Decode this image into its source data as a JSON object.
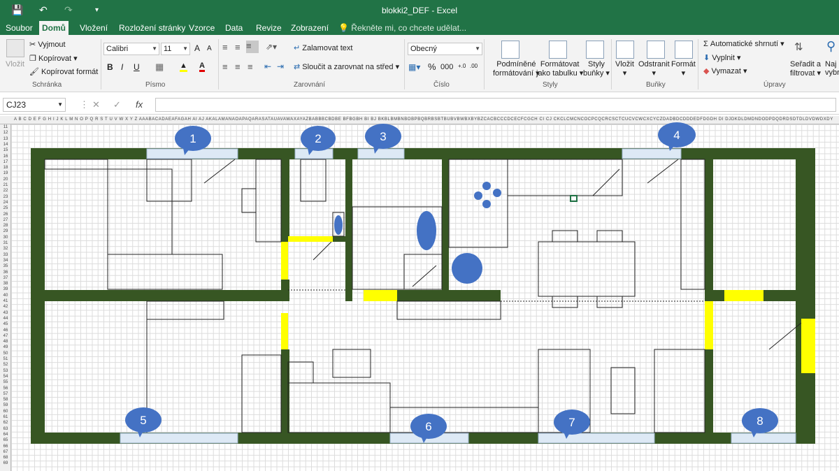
{
  "app": {
    "title": "blokki2_DEF - Excel"
  },
  "menu": {
    "tabs": [
      "Soubor",
      "Domů",
      "Vložení",
      "Rozložení stránky",
      "Vzorce",
      "Data",
      "Revize",
      "Zobrazení"
    ],
    "active_tab": "Domů",
    "tell_me": "Řekněte mi, co chcete udělat..."
  },
  "ribbon": {
    "clipboard": {
      "paste": "Vložit",
      "cut": "Vyjmout",
      "copy": "Kopírovat",
      "format_painter": "Kopírovat formát",
      "group": "Schránka"
    },
    "font": {
      "name": "Calibri",
      "size": "11",
      "bold": "B",
      "italic": "I",
      "underline": "U",
      "grow": "A",
      "shrink": "A",
      "group": "Písmo"
    },
    "alignment": {
      "wrap": "Zalamovat text",
      "merge": "Sloučit a zarovnat na střed",
      "group": "Zarovnání"
    },
    "number": {
      "format": "Obecný",
      "group": "Číslo"
    },
    "styles": {
      "conditional": [
        "Podmíněné",
        "formátování"
      ],
      "as_table": [
        "Formátovat",
        "jako tabulku"
      ],
      "cell_styles": [
        "Styly",
        "buňky"
      ],
      "group": "Styly"
    },
    "cells": {
      "insert": "Vložit",
      "delete": "Odstranit",
      "format": "Formát",
      "group": "Buňky"
    },
    "editing": {
      "autosum": "Automatické shrnutí",
      "fill": "Vyplnit",
      "clear": "Vymazat",
      "sort": [
        "Seřadit a",
        "filtrovat"
      ],
      "find": [
        "Naj",
        "vybra"
      ],
      "group": "Úpravy"
    }
  },
  "formula_bar": {
    "name_box": "CJ23",
    "fx": "fx",
    "value": ""
  },
  "column_headers": "A B C D E F G H I J K L M N O P Q R S T U V W X Y Z AAABACADAEAFAGAH AI AJ AKALAMANAOAPAQARASATAUAVAWAXAYAZBABBBCBDBE BFBGBH BI BJ BKBLBMBNBOBPBQBRBSBTBUBVBWBXBYBZCACBCCCDCECFCGCH CI CJ CKCLCMCNCOCPCQCRCSCTCUCVCWCXCYCZDADBDCDDDEDFDGDH DI DJDKDLDMDNDODPDQDRDSDTDLDVDWDXDY",
  "row_headers": [
    "11",
    "12",
    "13",
    "14",
    "15",
    "16",
    "17",
    "18",
    "19",
    "20",
    "21",
    "22",
    "23",
    "24",
    "25",
    "26",
    "27",
    "28",
    "29",
    "30",
    "31",
    "32",
    "33",
    "34",
    "35",
    "36",
    "37",
    "38",
    "39",
    "40",
    "41",
    "42",
    "43",
    "44",
    "45",
    "46",
    "47",
    "48",
    "49",
    "50",
    "51",
    "52",
    "53",
    "54",
    "55",
    "56",
    "57",
    "58",
    "59",
    "60",
    "61",
    "62",
    "63",
    "64",
    "65",
    "66",
    "67",
    "68",
    "69"
  ],
  "callouts": [
    "1",
    "2",
    "3",
    "4",
    "5",
    "6",
    "7",
    "8"
  ],
  "colors": {
    "excel_green": "#217346",
    "wall": "#375623",
    "door": "#ffff00",
    "window": "#dde9f5",
    "callout": "#4472c4"
  }
}
